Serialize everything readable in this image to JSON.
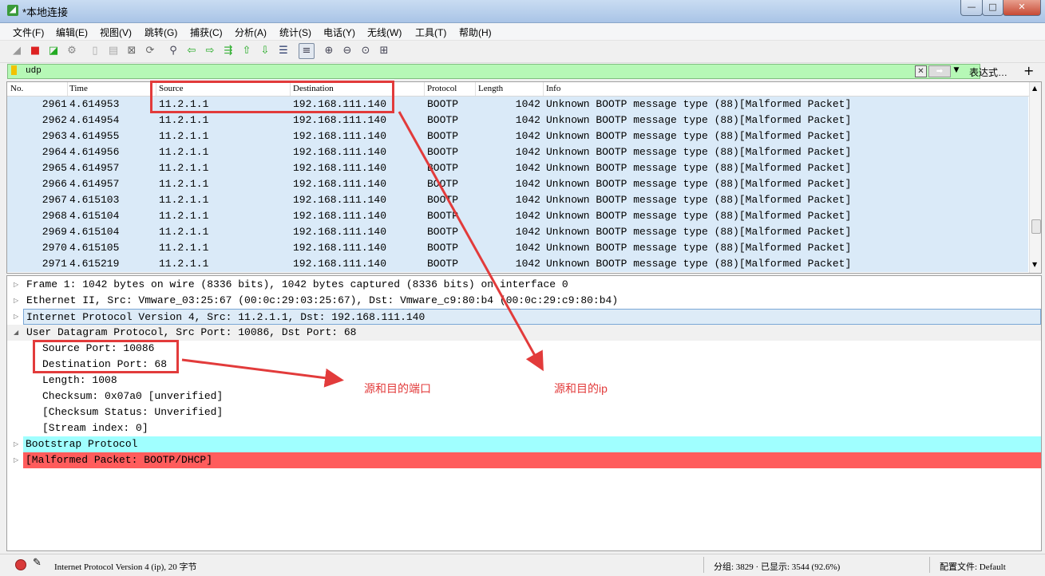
{
  "window": {
    "title": "*本地连接",
    "app_icon_glyph": "◢",
    "controls": {
      "minimize": "—",
      "maximize": "□",
      "close": "✕"
    }
  },
  "menu": [
    "文件(F)",
    "编辑(E)",
    "视图(V)",
    "跳转(G)",
    "捕获(C)",
    "分析(A)",
    "统计(S)",
    "电话(Y)",
    "无线(W)",
    "工具(T)",
    "帮助(H)"
  ],
  "toolbar_icons": [
    "shark-fin-start-icon",
    "stop-icon",
    "restart-icon",
    "options-icon",
    "open-icon",
    "save-icon",
    "close-file-icon",
    "reload-icon",
    "find-icon",
    "go-back-icon",
    "go-forward-icon",
    "go-to-packet-icon",
    "first-packet-icon",
    "last-packet-icon",
    "autoscroll-icon",
    "colorize-icon",
    "zoom-in-icon",
    "zoom-out-icon",
    "zoom-normal-icon",
    "resize-columns-icon"
  ],
  "filter": {
    "value": "udp",
    "clear_glyph": "✕",
    "apply_glyph": "➡",
    "dropdown_glyph": "▼",
    "expression_label": "表达式…",
    "add_glyph": "+",
    "color": "#b6f8b6"
  },
  "packet_list": {
    "columns": [
      "No.",
      "Time",
      "Source",
      "Destination",
      "Protocol",
      "Length",
      "Info"
    ],
    "rows": [
      {
        "no": "2961",
        "time": "4.614953",
        "src": "11.2.1.1",
        "dst": "192.168.111.140",
        "proto": "BOOTP",
        "len": "1042",
        "info": "Unknown BOOTP message type (88)[Malformed Packet]"
      },
      {
        "no": "2962",
        "time": "4.614954",
        "src": "11.2.1.1",
        "dst": "192.168.111.140",
        "proto": "BOOTP",
        "len": "1042",
        "info": "Unknown BOOTP message type (88)[Malformed Packet]"
      },
      {
        "no": "2963",
        "time": "4.614955",
        "src": "11.2.1.1",
        "dst": "192.168.111.140",
        "proto": "BOOTP",
        "len": "1042",
        "info": "Unknown BOOTP message type (88)[Malformed Packet]"
      },
      {
        "no": "2964",
        "time": "4.614956",
        "src": "11.2.1.1",
        "dst": "192.168.111.140",
        "proto": "BOOTP",
        "len": "1042",
        "info": "Unknown BOOTP message type (88)[Malformed Packet]"
      },
      {
        "no": "2965",
        "time": "4.614957",
        "src": "11.2.1.1",
        "dst": "192.168.111.140",
        "proto": "BOOTP",
        "len": "1042",
        "info": "Unknown BOOTP message type (88)[Malformed Packet]"
      },
      {
        "no": "2966",
        "time": "4.614957",
        "src": "11.2.1.1",
        "dst": "192.168.111.140",
        "proto": "BOOTP",
        "len": "1042",
        "info": "Unknown BOOTP message type (88)[Malformed Packet]"
      },
      {
        "no": "2967",
        "time": "4.615103",
        "src": "11.2.1.1",
        "dst": "192.168.111.140",
        "proto": "BOOTP",
        "len": "1042",
        "info": "Unknown BOOTP message type (88)[Malformed Packet]"
      },
      {
        "no": "2968",
        "time": "4.615104",
        "src": "11.2.1.1",
        "dst": "192.168.111.140",
        "proto": "BOOTP",
        "len": "1042",
        "info": "Unknown BOOTP message type (88)[Malformed Packet]"
      },
      {
        "no": "2969",
        "time": "4.615104",
        "src": "11.2.1.1",
        "dst": "192.168.111.140",
        "proto": "BOOTP",
        "len": "1042",
        "info": "Unknown BOOTP message type (88)[Malformed Packet]"
      },
      {
        "no": "2970",
        "time": "4.615105",
        "src": "11.2.1.1",
        "dst": "192.168.111.140",
        "proto": "BOOTP",
        "len": "1042",
        "info": "Unknown BOOTP message type (88)[Malformed Packet]"
      },
      {
        "no": "2971",
        "time": "4.615219",
        "src": "11.2.1.1",
        "dst": "192.168.111.140",
        "proto": "BOOTP",
        "len": "1042",
        "info": "Unknown BOOTP message type (88)[Malformed Packet]"
      }
    ],
    "row_color": "#daeaf8"
  },
  "details": {
    "frame": "Frame 1: 1042 bytes on wire (8336 bits), 1042 bytes captured (8336 bits) on interface 0",
    "ethernet": "Ethernet II, Src: Vmware_03:25:67 (00:0c:29:03:25:67), Dst: Vmware_c9:80:b4 (00:0c:29:c9:80:b4)",
    "ip": "Internet Protocol Version 4, Src: 11.2.1.1, Dst: 192.168.111.140",
    "udp": "User Datagram Protocol, Src Port: 10086, Dst Port: 68",
    "udp_fields": [
      "Source Port: 10086",
      "Destination Port: 68",
      "Length: 1008",
      "Checksum: 0x07a0 [unverified]",
      "[Checksum Status: Unverified]",
      "[Stream index: 0]"
    ],
    "bootp": "Bootstrap Protocol",
    "malformed": "[Malformed Packet: BOOTP/DHCP]",
    "collapsed_glyph": "▷",
    "expanded_glyph": "◢",
    "colors": {
      "ip": "#ddebf7",
      "bootp": "#a0ffff",
      "malformed": "#ff5c5c"
    }
  },
  "annotations": {
    "ports_label": "源和目的端口",
    "ip_label": "源和目的ip",
    "color": "#e23b3b"
  },
  "status": {
    "edit_glyph": "✎",
    "text": "Internet Protocol Version 4 (ip), 20 字节",
    "counts": "分组: 3829 · 已显示: 3544 (92.6%)",
    "profile": "配置文件: Default"
  }
}
